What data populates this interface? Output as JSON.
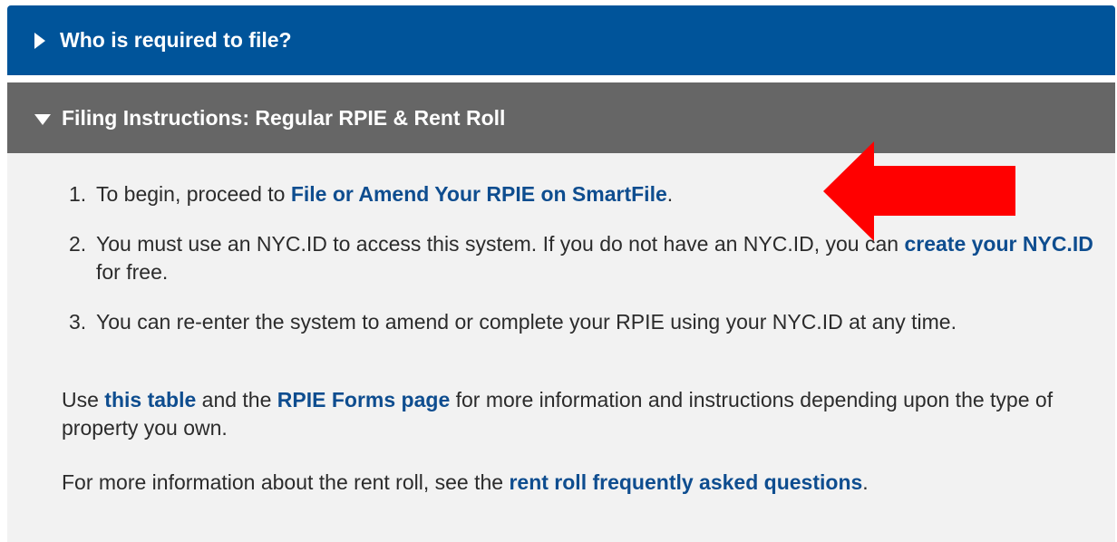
{
  "accordion": {
    "section1": {
      "title": "Who is required to file?",
      "icon": "caret-right-icon",
      "color": "#00549a"
    },
    "section2": {
      "title": "Filing Instructions: Regular RPIE & Rent Roll",
      "icon": "caret-down-icon",
      "color": "#666666"
    }
  },
  "content": {
    "steps": [
      {
        "num": "1.",
        "pre": "To begin, proceed to ",
        "link": "File or Amend Your RPIE on SmartFile",
        "post": "."
      },
      {
        "num": "2.",
        "pre": "You must use an NYC.ID to access this system. If you do not have an NYC.ID, you can ",
        "link": "create your NYC.ID",
        "post": " for free."
      },
      {
        "num": "3.",
        "text": "You can re-enter the system to amend or complete your RPIE using your NYC.ID at any time."
      }
    ],
    "para1": {
      "pre": "Use ",
      "link1": "this table",
      "mid": " and the ",
      "link2": "RPIE Forms page",
      "post": " for more information and instructions depending upon the type of property you own."
    },
    "para2": {
      "pre": "For more information about the rent roll, see the ",
      "link": "rent roll frequently asked questions",
      "post": "."
    }
  },
  "annotation": {
    "icon": "red-arrow-icon",
    "color": "#ff0000"
  }
}
